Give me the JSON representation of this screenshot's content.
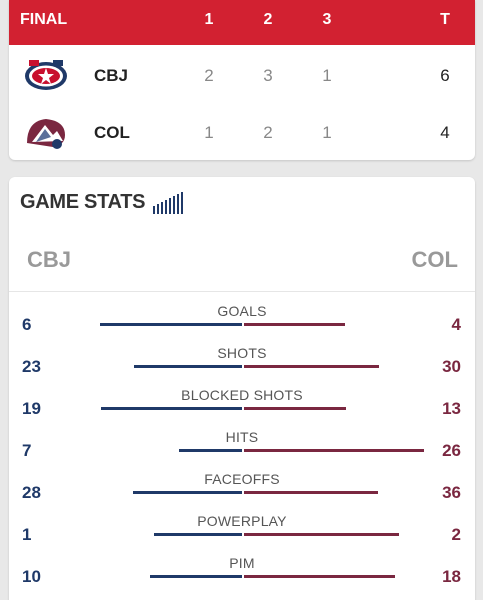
{
  "scoreboard": {
    "header": {
      "status": "FINAL",
      "periods": [
        "1",
        "2",
        "3"
      ],
      "total_label": "T"
    },
    "teams": [
      {
        "abbr": "CBJ",
        "logo": "blue-jackets-logo",
        "periods": [
          "2",
          "3",
          "1"
        ],
        "total": "6"
      },
      {
        "abbr": "COL",
        "logo": "avalanche-logo",
        "periods": [
          "1",
          "2",
          "1"
        ],
        "total": "4"
      }
    ]
  },
  "game_stats": {
    "title": "GAME STATS",
    "icon": "signal-bars-icon",
    "left_team": "CBJ",
    "right_team": "COL",
    "colors": {
      "left": "#1f3968",
      "right": "#7a2740",
      "accent": "#d22131"
    },
    "stats": [
      {
        "label": "GOALS",
        "left": "6",
        "right": "4"
      },
      {
        "label": "SHOTS",
        "left": "23",
        "right": "30"
      },
      {
        "label": "BLOCKED SHOTS",
        "left": "19",
        "right": "13"
      },
      {
        "label": "HITS",
        "left": "7",
        "right": "26"
      },
      {
        "label": "FACEOFFS",
        "left": "28",
        "right": "36"
      },
      {
        "label": "POWERPLAY",
        "left": "1",
        "right": "2"
      },
      {
        "label": "PIM",
        "left": "10",
        "right": "18"
      }
    ]
  }
}
